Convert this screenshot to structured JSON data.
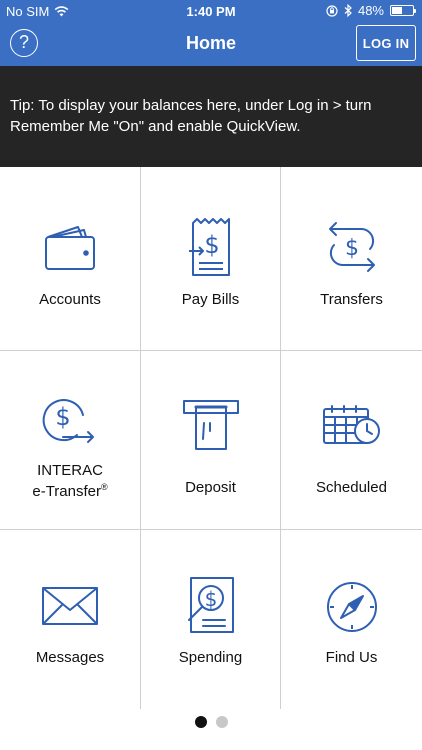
{
  "status_bar": {
    "carrier": "No SIM",
    "time": "1:40 PM",
    "battery": "48%",
    "battery_level": 0.48,
    "icons": [
      "wifi-icon",
      "orientation-lock-icon",
      "bluetooth-icon",
      "battery-icon"
    ]
  },
  "nav": {
    "help_label": "?",
    "title": "Home",
    "login_label": "LOG IN"
  },
  "tip": {
    "text": "Tip: To display your balances here, under Log in > turn Remember Me \"On\" and enable QuickView."
  },
  "tiles": [
    {
      "label": "Accounts",
      "icon": "wallet-icon"
    },
    {
      "label": "Pay Bills",
      "icon": "bill-icon"
    },
    {
      "label": "Transfers",
      "icon": "transfer-icon"
    },
    {
      "label_line1": "INTERAC",
      "label_line2": "e-Transfer",
      "label_sup": "®",
      "icon": "etransfer-icon"
    },
    {
      "label": "Deposit",
      "icon": "deposit-icon"
    },
    {
      "label": "Scheduled",
      "icon": "calendar-clock-icon"
    },
    {
      "label": "Messages",
      "icon": "envelope-icon"
    },
    {
      "label": "Spending",
      "icon": "spending-report-icon"
    },
    {
      "label": "Find Us",
      "icon": "compass-icon"
    }
  ],
  "pager": {
    "pages": 2,
    "current": 1
  },
  "colors": {
    "nav_blue": "#3a6fc4",
    "icon_blue": "#2f5fb3",
    "tip_bg": "#252525"
  }
}
